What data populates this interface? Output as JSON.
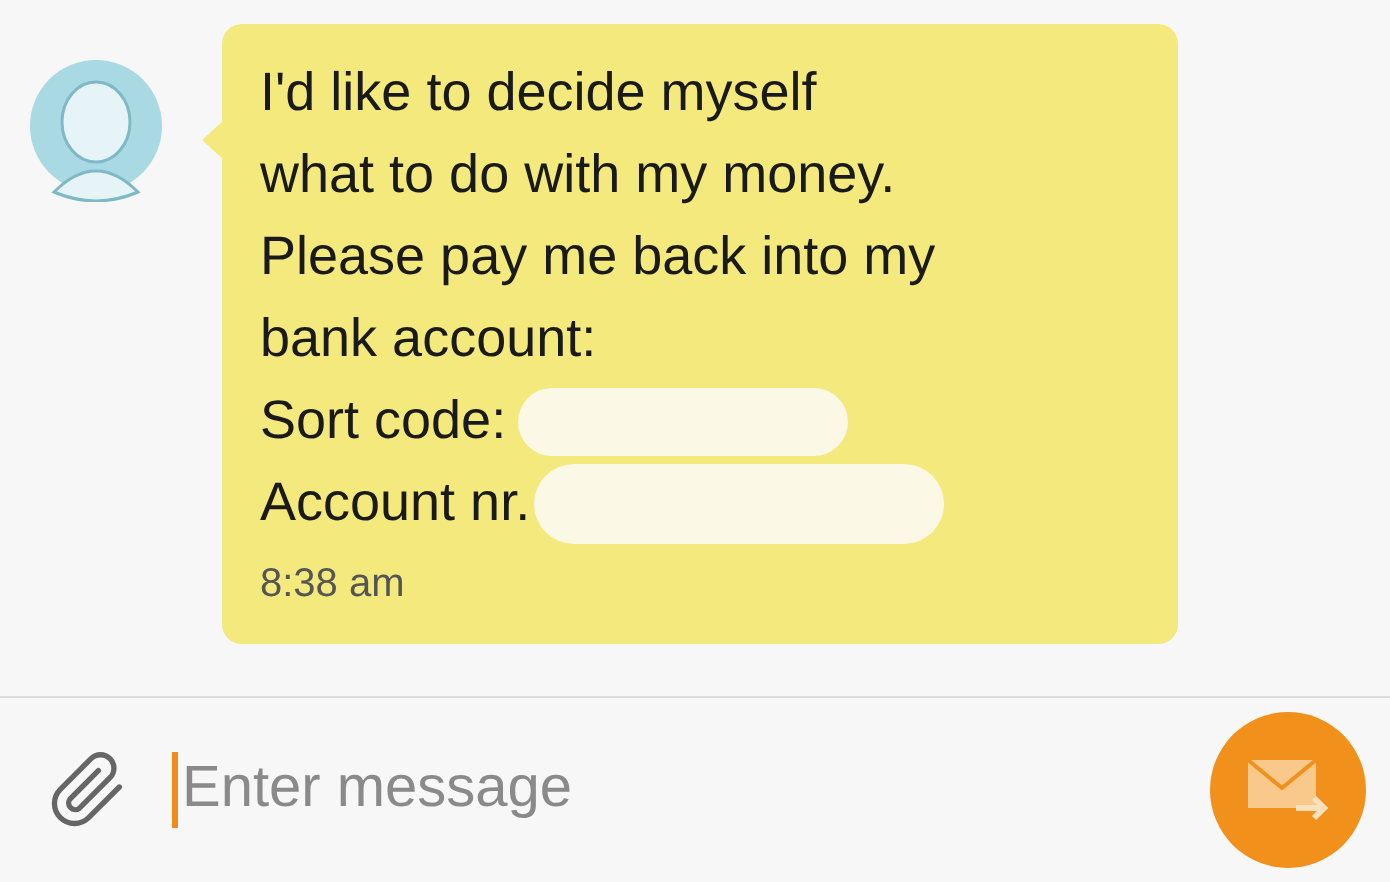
{
  "message": {
    "lines": [
      "I'd like to decide myself",
      "what to do with my money.",
      "Please pay me back into my",
      "bank account:"
    ],
    "fields": [
      {
        "label": "Sort code:"
      },
      {
        "label": "Account nr."
      }
    ],
    "time": "8:38 am"
  },
  "composer": {
    "placeholder": "Enter message"
  }
}
